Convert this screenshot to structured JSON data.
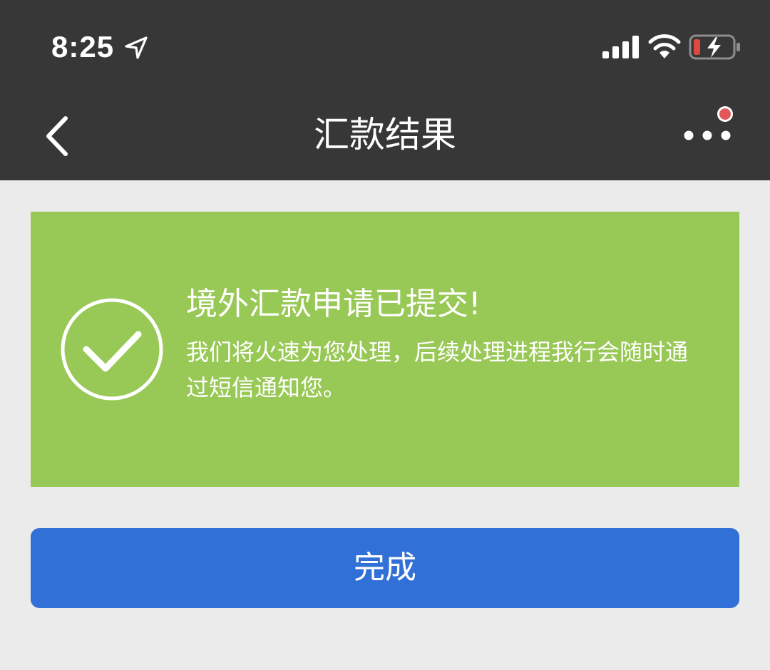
{
  "status_bar": {
    "time": "8:25",
    "icons": [
      "location-arrow-icon",
      "signal-icon",
      "wifi-icon",
      "battery-charging-icon"
    ],
    "battery_color": "#e0483f"
  },
  "nav": {
    "title": "汇款结果",
    "back_icon": "chevron-left-icon",
    "more_icon": "more-dots-icon",
    "notification_dot_color": "#e0585a"
  },
  "result": {
    "icon": "check-circle-icon",
    "title": "境外汇款申请已提交!",
    "message": "我们将火速为您处理，后续处理进程我行会随时通过短信通知您。",
    "background_color": "#98c855"
  },
  "actions": {
    "done_label": "完成",
    "button_color": "#3170d6"
  }
}
